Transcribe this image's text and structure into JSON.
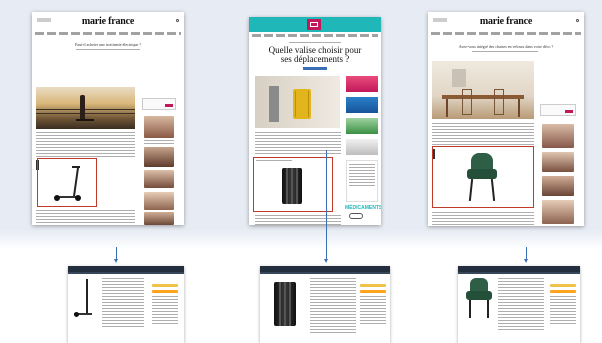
{
  "pages": [
    {
      "brand": "marie france",
      "headline": "Faut-il acheter une trottinette électrique ?",
      "product": "electric-scooter"
    },
    {
      "brand": "",
      "headline": "Quelle valise choisir pour ses déplacements ?",
      "product": "suitcase",
      "widget_label": "MÉDICAMENTS"
    },
    {
      "brand": "marie france",
      "headline": "Avez-vous intégré des chaises en velours dans votre déco ?",
      "product": "velvet-chair"
    }
  ],
  "colors": {
    "arrow": "#3a6fb6",
    "highlight": "#c0392b",
    "brand_pink": "#c2185b",
    "teal_header": "#1fb7b8"
  }
}
